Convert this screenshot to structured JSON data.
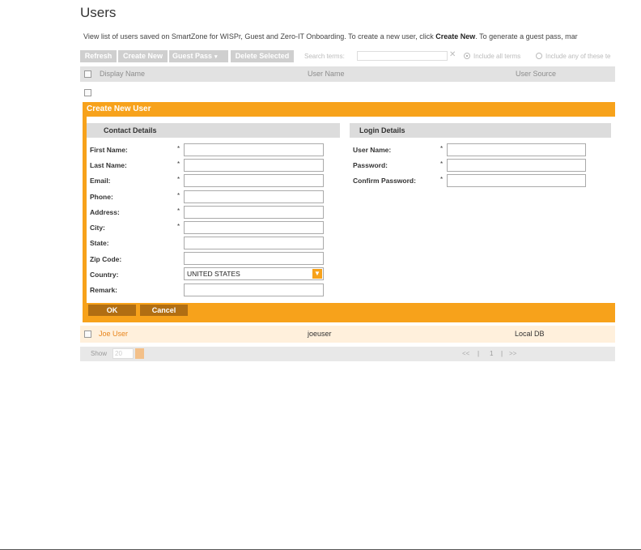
{
  "page": {
    "title": "Users",
    "description_prefix": "View list of users saved on SmartZone for WISPr, Guest and Zero-IT Onboarding. To create a new user, click ",
    "description_bold1": "Create New",
    "description_suffix": ". To generate a guest pass, mar"
  },
  "toolbar": {
    "refresh": "Refresh",
    "create_new": "Create New",
    "guest_pass": "Guest Pass",
    "guest_pass_dropdown": "▾",
    "delete_selected": "Delete Selected",
    "search_label": "Search terms:",
    "search_value": "",
    "clear_icon": "✕",
    "include_all": "Include all terms",
    "include_any": "Include any of these te"
  },
  "grid": {
    "columns": [
      "Display Name",
      "User Name",
      "User Source"
    ],
    "rows": [
      {
        "display_name": "Joe User",
        "user_name": "joeuser",
        "user_source": "Local DB"
      }
    ]
  },
  "form": {
    "title": "Create New User",
    "contact_section": "Contact Details",
    "login_section": "Login Details",
    "required_mark": "*",
    "contact_fields": [
      {
        "label": "First Name:",
        "required": true,
        "value": ""
      },
      {
        "label": "Last Name:",
        "required": true,
        "value": ""
      },
      {
        "label": "Email:",
        "required": true,
        "value": ""
      },
      {
        "label": "Phone:",
        "required": true,
        "value": ""
      },
      {
        "label": "Address:",
        "required": true,
        "value": ""
      },
      {
        "label": "City:",
        "required": true,
        "value": ""
      },
      {
        "label": "State:",
        "required": false,
        "value": ""
      },
      {
        "label": "Zip Code:",
        "required": false,
        "value": ""
      },
      {
        "label": "Country:",
        "required": false,
        "value": "UNITED STATES"
      },
      {
        "label": "Remark:",
        "required": false,
        "value": ""
      }
    ],
    "login_fields": [
      {
        "label": "User Name:",
        "required": true,
        "value": ""
      },
      {
        "label": "Password:",
        "required": true,
        "value": ""
      },
      {
        "label": "Confirm Password:",
        "required": true,
        "value": ""
      }
    ],
    "ok_label": "OK",
    "cancel_label": "Cancel"
  },
  "pager": {
    "show_label": "Show",
    "page_size": "20",
    "prev": "<<",
    "current_page": "1",
    "next": ">>",
    "separator": "|"
  },
  "colors": {
    "accent": "#f7a21b",
    "button_dark": "#b16e12",
    "row_highlight": "#fff0dc",
    "link": "#e8851c"
  }
}
